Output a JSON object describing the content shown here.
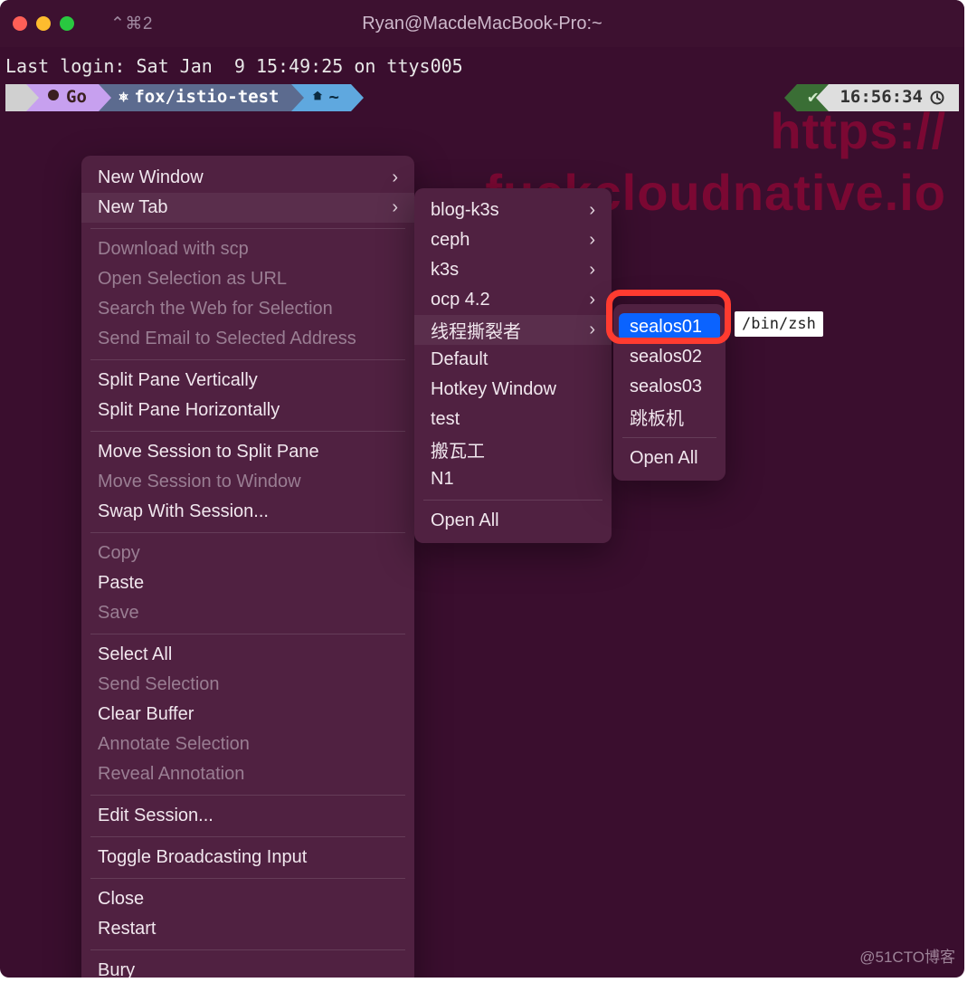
{
  "window": {
    "shortcut": "⌃⌘2",
    "title": "Ryan@MacdeMacBook-Pro:~"
  },
  "terminal": {
    "login_line": "Last login: Sat Jan  9 15:49:25 on ttys005",
    "seg_go": "Go",
    "seg_ctx": "fox/istio-test",
    "seg_home": "~",
    "right_ok": "✔",
    "right_time": "16:56:34"
  },
  "watermark": {
    "line1": "https://",
    "line2": "fuckcloudnative.io"
  },
  "credit": "@51CTO博客",
  "tooltip": "/bin/zsh",
  "menu_main": {
    "groups": [
      [
        {
          "label": "New Window",
          "disabled": false,
          "arrow": true,
          "hl": false
        },
        {
          "label": "New Tab",
          "disabled": false,
          "arrow": true,
          "hl": true
        }
      ],
      [
        {
          "label": "Download with scp",
          "disabled": true
        },
        {
          "label": "Open Selection as URL",
          "disabled": true
        },
        {
          "label": "Search the Web for Selection",
          "disabled": true
        },
        {
          "label": "Send Email to Selected Address",
          "disabled": true
        }
      ],
      [
        {
          "label": "Split Pane Vertically",
          "disabled": false
        },
        {
          "label": "Split Pane Horizontally",
          "disabled": false
        }
      ],
      [
        {
          "label": "Move Session to Split Pane",
          "disabled": false
        },
        {
          "label": "Move Session to Window",
          "disabled": true
        },
        {
          "label": "Swap With Session...",
          "disabled": false
        }
      ],
      [
        {
          "label": "Copy",
          "disabled": true
        },
        {
          "label": "Paste",
          "disabled": false
        },
        {
          "label": "Save",
          "disabled": true
        }
      ],
      [
        {
          "label": "Select All",
          "disabled": false
        },
        {
          "label": "Send Selection",
          "disabled": true
        },
        {
          "label": "Clear Buffer",
          "disabled": false
        },
        {
          "label": "Annotate Selection",
          "disabled": true
        },
        {
          "label": "Reveal Annotation",
          "disabled": true
        }
      ],
      [
        {
          "label": "Edit Session...",
          "disabled": false
        }
      ],
      [
        {
          "label": "Toggle Broadcasting Input",
          "disabled": false
        }
      ],
      [
        {
          "label": "Close",
          "disabled": false
        },
        {
          "label": "Restart",
          "disabled": false
        }
      ],
      [
        {
          "label": "Bury",
          "disabled": false
        }
      ]
    ]
  },
  "menu_sub1": {
    "groups": [
      [
        {
          "label": "blog-k3s",
          "arrow": true
        },
        {
          "label": "ceph",
          "arrow": true
        },
        {
          "label": "k3s",
          "arrow": true
        },
        {
          "label": "ocp 4.2",
          "arrow": true
        },
        {
          "label": "线程撕裂者",
          "arrow": true,
          "hl": true
        },
        {
          "label": "Default"
        },
        {
          "label": "Hotkey Window"
        },
        {
          "label": "test"
        },
        {
          "label": "搬瓦工"
        },
        {
          "label": "N1"
        }
      ],
      [
        {
          "label": "Open All"
        }
      ]
    ]
  },
  "menu_sub2": {
    "groups": [
      [
        {
          "label": "sealos01",
          "selected": true
        },
        {
          "label": "sealos02"
        },
        {
          "label": "sealos03"
        },
        {
          "label": "跳板机"
        }
      ],
      [
        {
          "label": "Open All"
        }
      ]
    ]
  }
}
